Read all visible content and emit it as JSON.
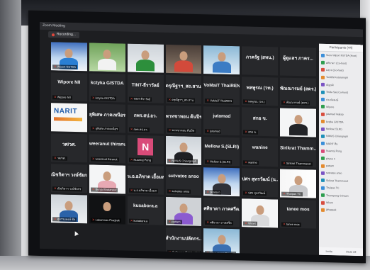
{
  "window": {
    "title": "Zoom Meeting",
    "recording": "Recording..."
  },
  "tiles": [
    {
      "kind": "photo",
      "bg": "bg-slide",
      "person": "#2a7fd4",
      "label": "Wiport NSTDA"
    },
    {
      "kind": "photo",
      "bg": "bg-green",
      "person": "#f2f2f2",
      "label": ""
    },
    {
      "kind": "photo",
      "bg": "bg-office",
      "person": "#2d8f3c",
      "label": ""
    },
    {
      "kind": "photo",
      "bg": "bg-room",
      "person": "#d24a3b",
      "label": ""
    },
    {
      "kind": "photo",
      "bg": "bg-lab",
      "person": "#3c7cc4",
      "label": ""
    },
    {
      "kind": "name",
      "name": "ภาครัฐ (สทน.)",
      "label": ""
    },
    {
      "kind": "name",
      "name": "ผู้ดูแลฯ ภาคร...",
      "label": ""
    },
    {
      "kind": "name",
      "name": "Wipore NII",
      "label": "Wipore NII"
    },
    {
      "kind": "name",
      "name": "kctyka GISTDA",
      "label": "kctyka GISTDA"
    },
    {
      "kind": "name",
      "name": "TINT-ธีราวัลย์",
      "label": "TINT ธีราวัลย์"
    },
    {
      "kind": "name",
      "name": "ดรุณีฐาฯ_สถ.สาน...",
      "label": "ดรุณีฐาฯ_สถ.สาน"
    },
    {
      "kind": "name",
      "name": "VoMaiT ThaiREN",
      "label": "VoMaiT ThaiREN"
    },
    {
      "kind": "name",
      "name": "พลพูรณ (วท.)",
      "label": "พลพูรณ (วท.)"
    },
    {
      "kind": "name",
      "name": "พัณณารมย์ (สดร.)",
      "label": "พัณณารมย์ (สดร.)"
    },
    {
      "kind": "nari",
      "text": "NARIT",
      "label": ""
    },
    {
      "kind": "name",
      "name": "ยุพิเศษ ภาคเหนือร ข...",
      "label": "ยุพิเศษ ภาคเหนือร"
    },
    {
      "kind": "name",
      "name": "กพร.สป.อว.",
      "label": "กพร.สป.อว."
    },
    {
      "kind": "name",
      "name": "พาทชาทอน ต้นปีช...",
      "label": "พาทชาทอน ต้นปีช"
    },
    {
      "kind": "name",
      "name": "jutamad",
      "label": "jutamad"
    },
    {
      "kind": "name",
      "name": "สกอ ข.",
      "label": "สกอ ข."
    },
    {
      "kind": "photo",
      "bg": "bg-white",
      "person": "#222428",
      "label": ""
    },
    {
      "kind": "name",
      "name": "วศ/วศ.",
      "label": "วศ/วศ."
    },
    {
      "kind": "name",
      "name": "weeranut thiranut",
      "label": "weeranut thiranut"
    },
    {
      "kind": "avatar",
      "letter": "N",
      "label": "Nuanroj Pong"
    },
    {
      "kind": "photo",
      "bg": "bg-office",
      "person": "#1f2024",
      "label": "NIMUS Chiangraph"
    },
    {
      "kind": "name",
      "name": "Mellow S.(SLRI)",
      "label": "Mellow S.(SLRI)"
    },
    {
      "kind": "name",
      "name": "wanine",
      "label": "wanine"
    },
    {
      "kind": "name",
      "name": "Sirikrat Thamm...",
      "label": "Sirikrat Thammasat"
    },
    {
      "kind": "name",
      "name": "ณิชกิตาฯ วงษ์ชัยกร",
      "label": "ณิชกิตาฯ วงษ์ชัยกร"
    },
    {
      "kind": "photo",
      "bg": "bg-white",
      "person": "#e7a9b3",
      "label": "Benja Bhatanpur"
    },
    {
      "kind": "name",
      "name": "น.อ.อภิชาต เอื้อมส...",
      "label": "น.อ.อภิชาต เอื้อมส"
    },
    {
      "kind": "name",
      "name": "sutvatee anso",
      "label": "sutvatee anso"
    },
    {
      "kind": "photo",
      "bg": "bg-slide",
      "person": "#2f3138",
      "label": "pirasa n"
    },
    {
      "kind": "name",
      "name": "ปศร สุทรวัฒน์ (น...",
      "label": "ปศร สุทรวัฒน์"
    },
    {
      "kind": "photo",
      "bg": "bg-banner",
      "person": "#c8c9cc",
      "label": "Thaipas TC"
    },
    {
      "kind": "photo",
      "bg": "bg-office",
      "person": "#2b62a8",
      "label": "สุทรรมพงษ์ ชัย"
    },
    {
      "kind": "photo",
      "bg": "bg-dark",
      "person": "#111214",
      "label": "Lakanmas Pradyak"
    },
    {
      "kind": "name",
      "name": "kusabora.a",
      "label": "kusabora.a"
    },
    {
      "kind": "photo",
      "bg": "bg-pink",
      "person": "#8b5bd0",
      "label": "pattam"
    },
    {
      "kind": "name",
      "name": "ศศิธาดา ภาคศรีต...",
      "label": "ศศิธาดา ภาคศรีต"
    },
    {
      "kind": "photo",
      "bg": "bg-white",
      "person": "#d9dadc",
      "label": "Wiswt"
    },
    {
      "kind": "name",
      "name": "tanee mos",
      "label": "tanee mos"
    },
    {
      "kind": "empty"
    },
    {
      "kind": "empty"
    },
    {
      "kind": "empty"
    },
    {
      "kind": "name",
      "name": "สำนักงานปลัดกร...",
      "label": "สำนักงานปลัดกระทรวง"
    },
    {
      "kind": "photo",
      "bg": "bg-lab",
      "person": "#3a6fb2",
      "label": "Thanapong Srinaan"
    },
    {
      "kind": "empty"
    },
    {
      "kind": "empty"
    }
  ],
  "panel": {
    "title": "Participants (44)",
    "rows": [
      {
        "name": "Suzu Wiport NSTDA (Host)",
        "color": "#3b8fd9"
      },
      {
        "name": "ศศิธาดา (Co-host)",
        "color": "#2e9e4f"
      },
      {
        "name": "มธุรส (Co-host)",
        "color": "#d84d3e"
      },
      {
        "name": "Tanitthi Ketaranoph",
        "color": "#e38a2e"
      },
      {
        "name": "ณัฐวุฒิ",
        "color": "#7a53c4"
      },
      {
        "name": "Thida Sai (Co-host)",
        "color": "#1e90b8"
      },
      {
        "name": "ประหัดพงษ์",
        "color": "#3b8fd9"
      },
      {
        "name": "Wipore",
        "color": "#2e9e4f"
      },
      {
        "name": "jutamad Vejkap",
        "color": "#d84d3e"
      },
      {
        "name": "kctyka GISTDA",
        "color": "#e38a2e"
      },
      {
        "name": "Mellow (SLRI)",
        "color": "#7a53c4"
      },
      {
        "name": "NIMUS Chiangraph",
        "color": "#1e90b8"
      },
      {
        "name": "NARIT ทีม",
        "color": "#3b8fd9"
      },
      {
        "name": "Nuanroj Pong",
        "color": "#d94b79"
      },
      {
        "name": "pirasa n",
        "color": "#2e9e4f"
      },
      {
        "name": "pattam",
        "color": "#e38a2e"
      },
      {
        "name": "sutvatee anso",
        "color": "#7a53c4"
      },
      {
        "name": "Sirikrat Thammasat",
        "color": "#1e90b8"
      },
      {
        "name": "Thaipas TC",
        "color": "#3b8fd9"
      },
      {
        "name": "Thanapong Srinaan",
        "color": "#2e9e4f"
      },
      {
        "name": "Wiswt",
        "color": "#d84d3e"
      },
      {
        "name": "jithuppak",
        "color": "#e38a2e"
      }
    ],
    "invite": "Invite",
    "mute_all": "Mute All"
  }
}
